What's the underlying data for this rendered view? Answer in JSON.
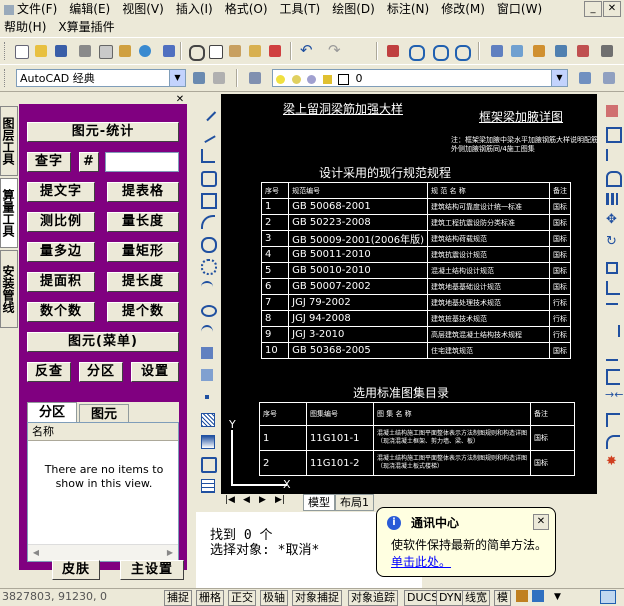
{
  "menu": {
    "row1": [
      "文件(F)",
      "编辑(E)",
      "视图(V)",
      "插入(I)",
      "格式(O)",
      "工具(T)",
      "绘图(D)",
      "标注(N)",
      "修改(M)",
      "窗口(W)"
    ],
    "row2": [
      "帮助(H)",
      "X算量插件"
    ]
  },
  "toolbar2": {
    "workspace": "AutoCAD 经典",
    "layer": "0"
  },
  "vtabs": [
    "图层工具",
    "算量工具",
    "安装管线"
  ],
  "panel": {
    "title_btn": "图元-统计",
    "find_btn": "查字",
    "hash_btn": "#",
    "grid": [
      [
        "提文字",
        "提表格"
      ],
      [
        "测比例",
        "量长度"
      ],
      [
        "量多边",
        "量矩形"
      ],
      [
        "提面积",
        "提长度"
      ],
      [
        "数个数",
        "提个数"
      ]
    ],
    "menu_btn": "图元(菜单)",
    "row3": [
      "反查",
      "分区",
      "设置"
    ],
    "tabs": [
      "分区",
      "图元"
    ],
    "list_header": "名称",
    "empty_msg": "There are no items to show in this view.",
    "skin_btn": "皮肤",
    "main_settings_btn": "主设置"
  },
  "drawing": {
    "title_left": "梁上留洞梁筋加强大样",
    "title_right": "框架梁加腋详图",
    "note_right": "注：框架梁加腋中梁水平加腋钢筋大样说明配筋\n外侧加腋钢筋同/4施工图集",
    "spec_title": "设计采用的现行规范规程",
    "spec_header": [
      "序号",
      "规范编号",
      "规 范 名 称",
      "备注"
    ],
    "spec_rows": [
      [
        "1",
        "GB 50068-2001",
        "建筑结构可靠度设计统一标准",
        "国标"
      ],
      [
        "2",
        "GB 50223-2008",
        "建筑工程抗震设防分类标准",
        "国标"
      ],
      [
        "3",
        "GB 50009-2001(2006年版)",
        "建筑结构荷载规范",
        "国标"
      ],
      [
        "4",
        "GB 50011-2010",
        "建筑抗震设计规范",
        "国标"
      ],
      [
        "5",
        "GB 50010-2010",
        "混凝土结构设计规范",
        "国标"
      ],
      [
        "6",
        "GB 50007-2002",
        "建筑地基基础设计规范",
        "国标"
      ],
      [
        "7",
        "JGJ 79-2002",
        "建筑地基处理技术规范",
        "行标"
      ],
      [
        "8",
        "JGJ 94-2008",
        "建筑桩基技术规范",
        "行标"
      ],
      [
        "9",
        "JGJ 3-2010",
        "高层建筑混凝土结构技术规程",
        "行标"
      ],
      [
        "10",
        "GB 50368-2005",
        "住宅建筑规范",
        "国标"
      ]
    ],
    "atlas_title": "选用标准图集目录",
    "atlas_header": [
      "序号",
      "图集编号",
      "图 集 名 称",
      "备注"
    ],
    "atlas_rows": [
      [
        "1",
        "11G101-1",
        "混凝土结构施工图平面整体表示方法制图规则和构造详图（现浇混凝土框架、剪力墙、梁、板）",
        "国标"
      ],
      [
        "2",
        "11G101-2",
        "混凝土结构施工图平面整体表示方法制图规则和构造详图（现浇混凝土板式楼梯）",
        "国标"
      ]
    ],
    "axis_y": "Y",
    "axis_x": "X",
    "layout_tabs": [
      "模型",
      "布局1"
    ]
  },
  "command": {
    "line1": "找到 0 个",
    "line2": "选择对象: *取消*"
  },
  "balloon": {
    "title": "通讯中心",
    "body": "使软件保持最新的简单方法。",
    "link": "单击此处。"
  },
  "status": {
    "coords": "3827803, 91230, 0",
    "buttons": [
      "捕捉",
      "栅格",
      "正交",
      "极轴",
      "对象捕捉",
      "对象追踪",
      "DUCS",
      "DYN",
      "线宽",
      "模"
    ]
  }
}
